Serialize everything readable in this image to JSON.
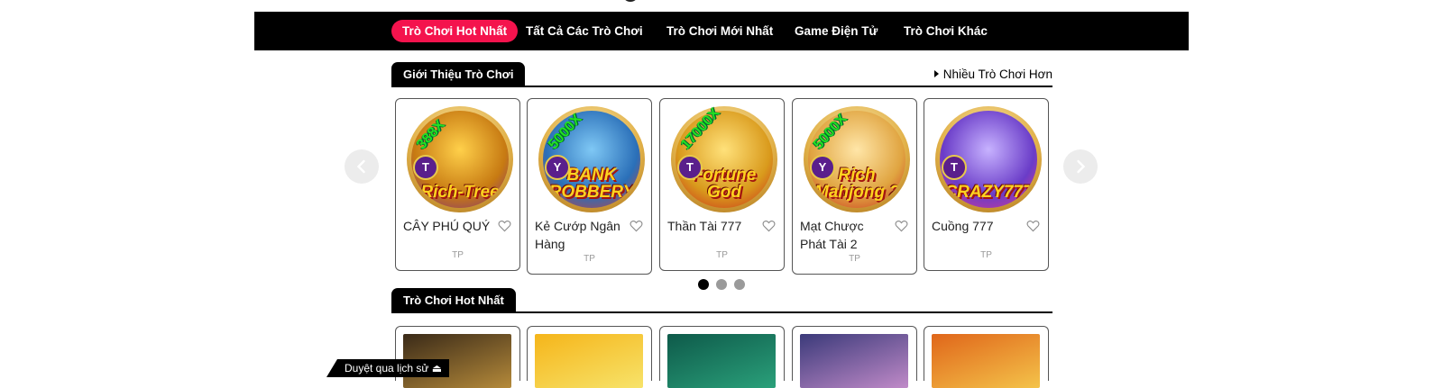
{
  "nav": {
    "items": [
      {
        "label": "Trò Chơi Hot Nhất",
        "active": true
      },
      {
        "label": "Tất Cả Các Trò Chơi",
        "active": false
      },
      {
        "label": "Trò Chơi Mới Nhất",
        "active": false
      },
      {
        "label": "Game Điện Tử",
        "active": false
      },
      {
        "label": "Trò Chơi Khác",
        "active": false
      }
    ]
  },
  "intro_section": {
    "title": "Giới Thiệu Trò Chơi",
    "more_link": "Nhiều Trò Chơi Hơn"
  },
  "carousel": {
    "cards": [
      {
        "title": "CÂY PHÚ QUÝ",
        "provider": "TP",
        "multiplier": "388X",
        "badge": "T",
        "logo": "Rich-Tree",
        "colors": [
          "#ffd04a",
          "#c77a12",
          "#7c2a86"
        ]
      },
      {
        "title": "Kẻ Cướp Ngân Hàng",
        "provider": "TP",
        "multiplier": "5000X",
        "badge": "Y",
        "logo": "BANK ROBBERY",
        "colors": [
          "#7fc8f5",
          "#2a6fb8",
          "#e33a2a"
        ]
      },
      {
        "title": "Thần Tài 777",
        "provider": "TP",
        "multiplier": "17000X",
        "badge": "T",
        "logo": "Fortune God",
        "colors": [
          "#ffe17a",
          "#d99a1c",
          "#c8221b"
        ]
      },
      {
        "title": "Mạt Chược Phát Tài 2",
        "provider": "TP",
        "multiplier": "5000X",
        "badge": "Y",
        "logo": "Rich Mahjong 2",
        "colors": [
          "#ffe6a8",
          "#e0a440",
          "#c9281e"
        ]
      },
      {
        "title": "Cuồng 777",
        "provider": "TP",
        "multiplier": "",
        "badge": "T",
        "logo": "CRAZY777",
        "colors": [
          "#c7b2ff",
          "#6a3cc8",
          "#e83a8a"
        ]
      }
    ],
    "dots": 3,
    "active_dot": 0
  },
  "hot_section": {
    "title": "Trò Chơi Hot Nhất",
    "thumb_colors": [
      [
        "#3a2a18",
        "#b58a3a"
      ],
      [
        "#f5b51a",
        "#f7e36a"
      ],
      [
        "#0e5a4a",
        "#2aa07a"
      ],
      [
        "#3b3a7a",
        "#c08ac8"
      ],
      [
        "#e0661a",
        "#f4c34a"
      ]
    ]
  },
  "history_tab": "Duyệt qua lịch sử"
}
